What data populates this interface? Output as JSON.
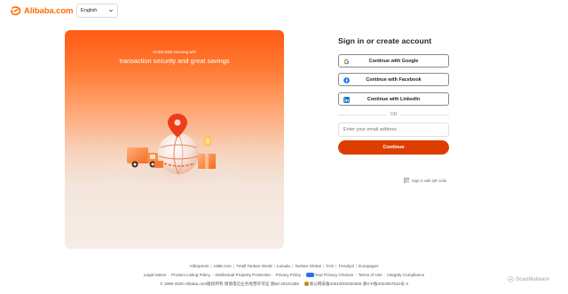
{
  "header": {
    "brand": "Alibaba.com",
    "language": "English"
  },
  "promo": {
    "small_text": "Global B2B sourcing with",
    "headline": "transaction security and great savings"
  },
  "signin": {
    "title": "Sign in or create account",
    "google_label": "Continue with Google",
    "facebook_label": "Continue with Facebook",
    "linkedin_label": "Continue with LinkedIn",
    "or_label": "OR",
    "email_placeholder": "Enter your email address",
    "continue_label": "Continue",
    "qr_label": "Sign in with QR code"
  },
  "footer": {
    "brands": [
      "AliExpress",
      "1688.com",
      "Tmall Taobao World",
      "Lazada",
      "Taobao Global",
      "TAO",
      "Trendyol",
      "Europages"
    ],
    "legal": [
      "Legal Notice",
      "Product Listing Policy",
      "Intellectual Property Protection",
      "Privacy Policy",
      "Your Privacy Choices",
      "Terms of Use",
      "Integrity Compliance"
    ],
    "copyright": "© 1999-2026 Alibaba.com版权所有 增值电信业务经营许可证 浙B2-20241358",
    "beian": "浙公网安备33010002000366 浙ICP备2024067534号-3"
  },
  "watermark": "ScanMalware",
  "colors": {
    "brand_orange": "#ff6a00",
    "continue_button": "#de3d00"
  }
}
